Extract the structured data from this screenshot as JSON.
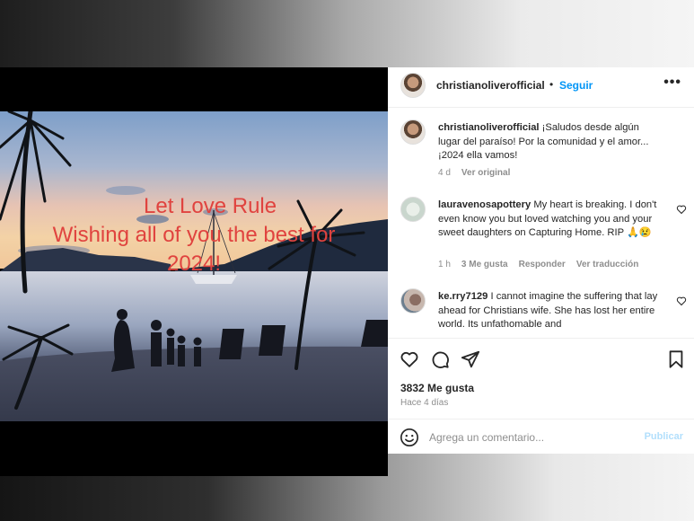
{
  "post": {
    "username": "christianoliverofficial",
    "follow_label": "Seguir",
    "separator": "•",
    "more_label": "•••"
  },
  "image_overlay": {
    "line1": "Let Love Rule",
    "line2": "Wishing all of you the best for",
    "line3": "2024!"
  },
  "caption": {
    "username": "christianoliverofficial",
    "text": "¡Saludos desde algún lugar del paraíso! Por la comunidad y el amor... ¡2024 ella vamos!",
    "time": "4 d",
    "see_original": "Ver original"
  },
  "comments": [
    {
      "username": "lauravenosapottery",
      "text": "My heart is breaking. I don't even know you but loved watching you and your sweet daughters on Capturing Home. RIP 🙏😢",
      "time": "1 h",
      "likes": "3 Me gusta",
      "reply": "Responder",
      "translate": "Ver traducción"
    },
    {
      "username": "ke.rry7129",
      "text": "I cannot imagine the suffering that lay ahead for Christians wife. She has lost her entire world. Its unfathomable and"
    }
  ],
  "stats": {
    "likes": "3832 Me gusta",
    "posted": "Hace 4 días"
  },
  "composer": {
    "placeholder": "Agrega un comentario...",
    "publish_label": "Publicar"
  },
  "colors": {
    "link_blue": "#0095f6",
    "overlay_red": "#e0433f",
    "muted": "#8e8e8e"
  },
  "icons": [
    "heart-icon",
    "comment-icon",
    "share-icon",
    "bookmark-icon",
    "emoji-icon",
    "more-icon"
  ]
}
